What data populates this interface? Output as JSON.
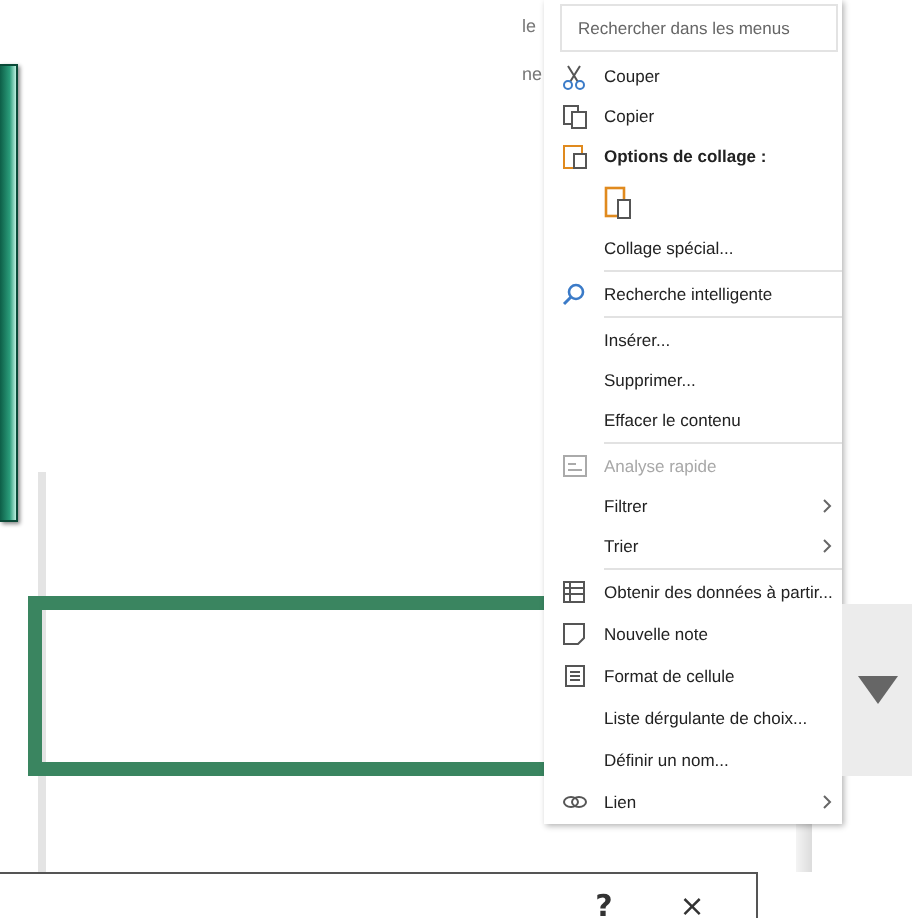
{
  "sheet_fragments": [
    {
      "text": "le"
    },
    {
      "text": "ne"
    }
  ],
  "context_menu": {
    "search": {
      "placeholder": "Rechercher dans les menus"
    },
    "items": [
      {
        "kind": "cut",
        "label": "Couper",
        "disabled": false,
        "submenu": false
      },
      {
        "kind": "copy",
        "label": "Copier",
        "disabled": false,
        "submenu": false
      },
      {
        "kind": "header",
        "label": "Options de collage :",
        "disabled": false,
        "submenu": false
      },
      {
        "kind": "paste_option"
      },
      {
        "kind": "plain",
        "label": "Collage spécial...",
        "disabled": false,
        "submenu": false
      },
      {
        "kind": "separator"
      },
      {
        "kind": "lookup",
        "label": "Recherche intelligente",
        "disabled": false,
        "submenu": false
      },
      {
        "kind": "separator"
      },
      {
        "kind": "plain",
        "label": "Insérer...",
        "disabled": false,
        "submenu": false
      },
      {
        "kind": "plain",
        "label": "Supprimer...",
        "disabled": false,
        "submenu": false
      },
      {
        "kind": "plain",
        "label": "Effacer le contenu",
        "disabled": false,
        "submenu": false
      },
      {
        "kind": "separator"
      },
      {
        "kind": "analysis",
        "label": "Analyse rapide",
        "disabled": true,
        "submenu": false
      },
      {
        "kind": "plain",
        "label": "Filtrer",
        "disabled": false,
        "submenu": true
      },
      {
        "kind": "plain",
        "label": "Trier",
        "disabled": false,
        "submenu": true
      },
      {
        "kind": "separator"
      },
      {
        "kind": "table",
        "label": "Obtenir des données à partir...",
        "disabled": false,
        "submenu": false
      },
      {
        "kind": "note",
        "label": "Nouvelle note",
        "disabled": false,
        "submenu": false
      },
      {
        "kind": "format",
        "label": "Format de cellule",
        "disabled": false,
        "submenu": false
      },
      {
        "kind": "plain",
        "label": "Liste dérgulante de choix...",
        "disabled": false,
        "submenu": false
      },
      {
        "kind": "plain",
        "label": "Définir un nom...",
        "disabled": false,
        "submenu": false
      },
      {
        "kind": "link",
        "label": "Lien",
        "disabled": false,
        "submenu": true
      }
    ]
  },
  "dialog": {
    "buttons": [
      {
        "kind": "help",
        "label": "?"
      },
      {
        "kind": "close",
        "label": "×"
      }
    ]
  }
}
